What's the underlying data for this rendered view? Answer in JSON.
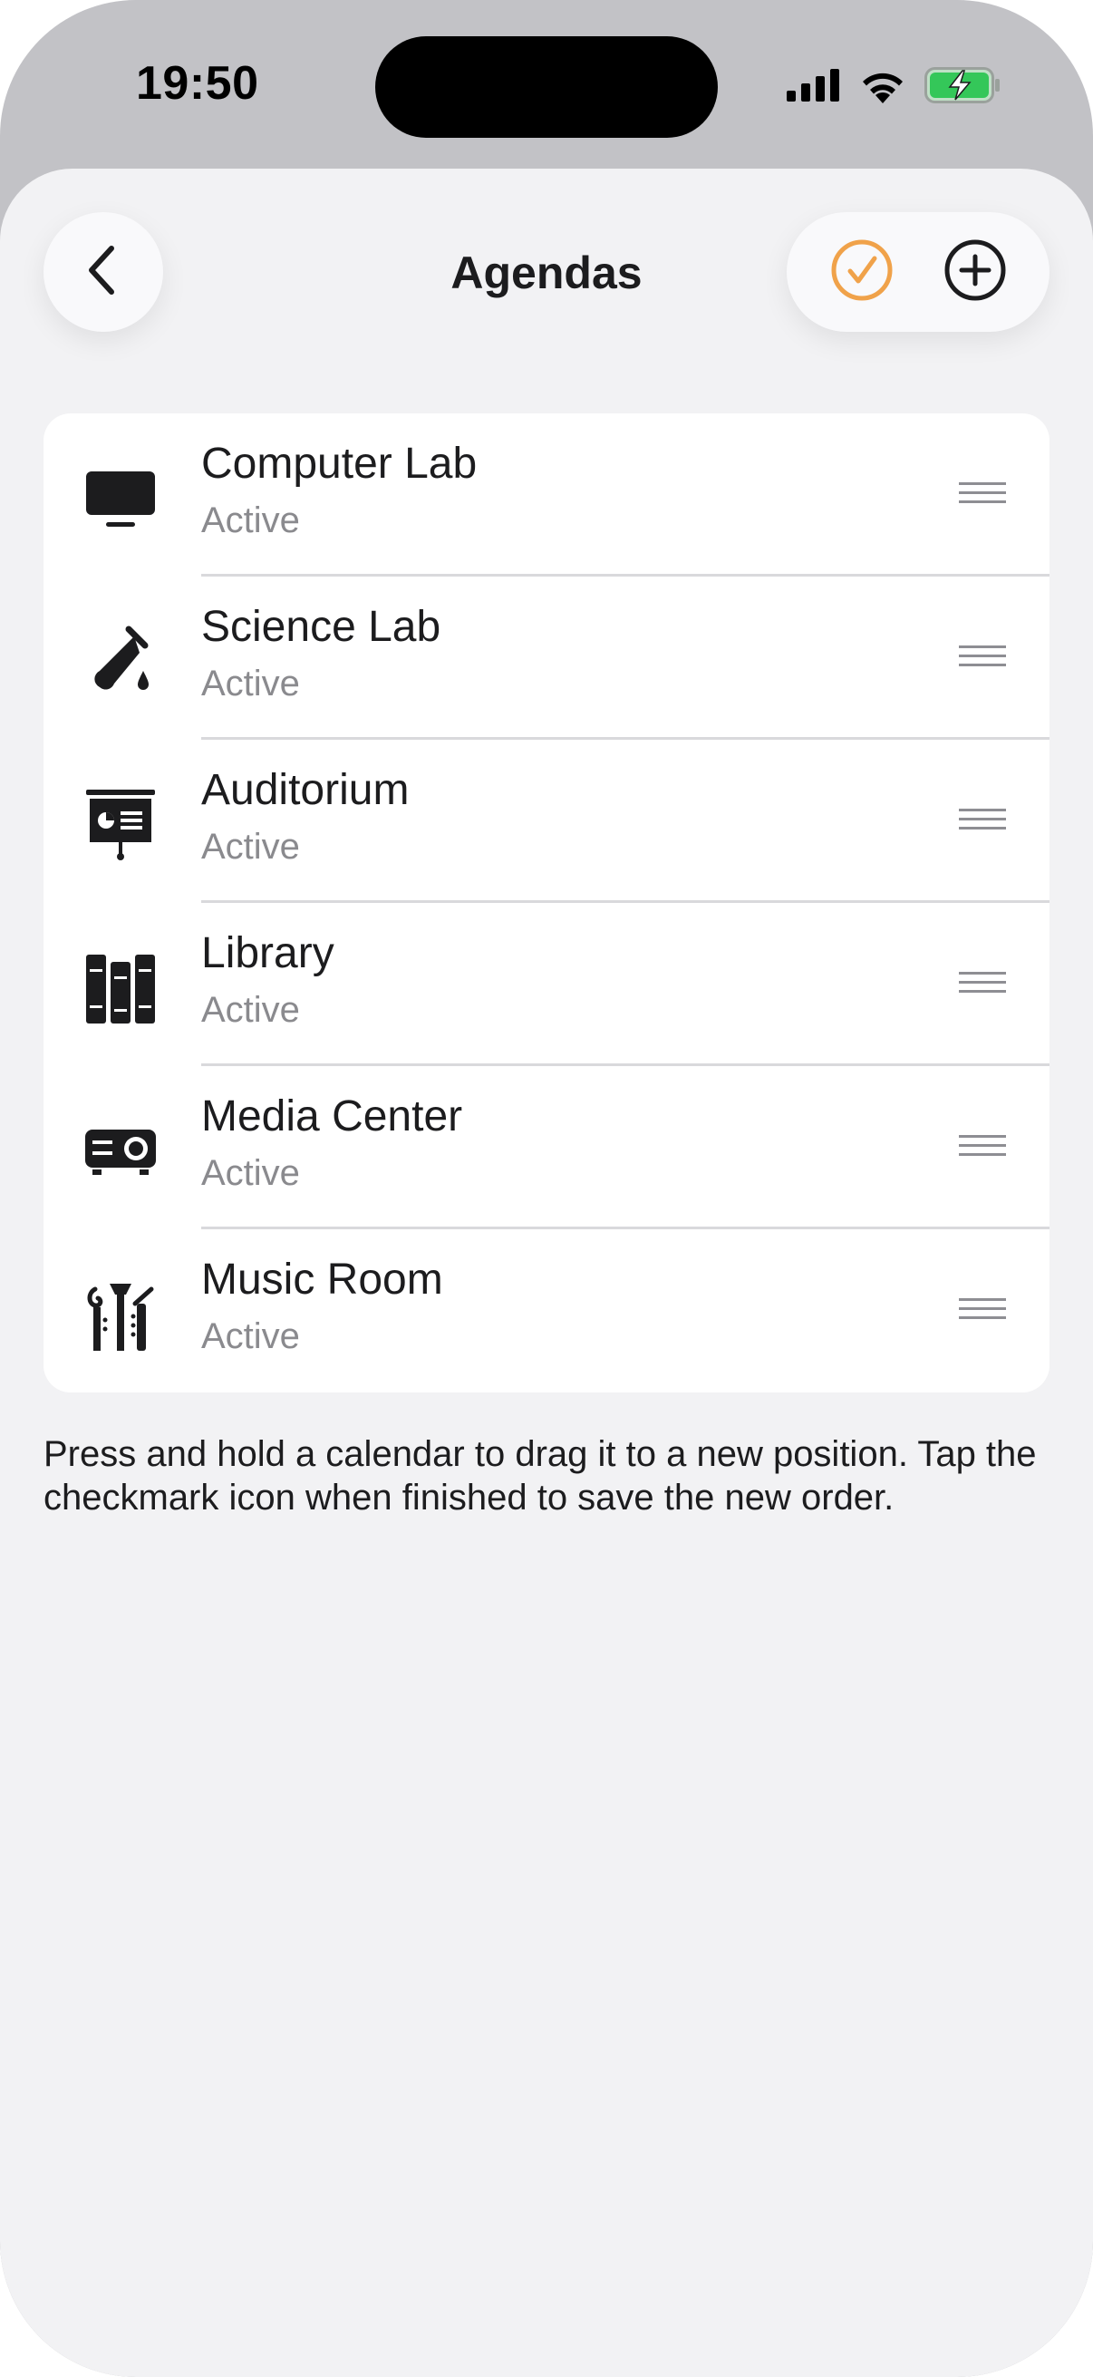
{
  "status_bar": {
    "time": "19:50",
    "icons": [
      "cellular-signal-icon",
      "wifi-icon",
      "battery-charging-icon"
    ]
  },
  "nav": {
    "title": "Agendas",
    "back_icon": "chevron-left-icon",
    "done_icon": "checkmark-circle-icon",
    "add_icon": "plus-circle-icon",
    "accent_color": "#f0a24a"
  },
  "agendas": [
    {
      "name": "Computer Lab",
      "status": "Active",
      "icon": "monitor-icon"
    },
    {
      "name": "Science Lab",
      "status": "Active",
      "icon": "test-tube-icon"
    },
    {
      "name": "Auditorium",
      "status": "Active",
      "icon": "presentation-board-icon"
    },
    {
      "name": "Library",
      "status": "Active",
      "icon": "books-icon"
    },
    {
      "name": "Media Center",
      "status": "Active",
      "icon": "projector-icon"
    },
    {
      "name": "Music Room",
      "status": "Active",
      "icon": "music-instruments-icon"
    }
  ],
  "hint_text": "Press and hold a calendar to drag it to a new position. Tap the checkmark icon when finished to save the new order."
}
